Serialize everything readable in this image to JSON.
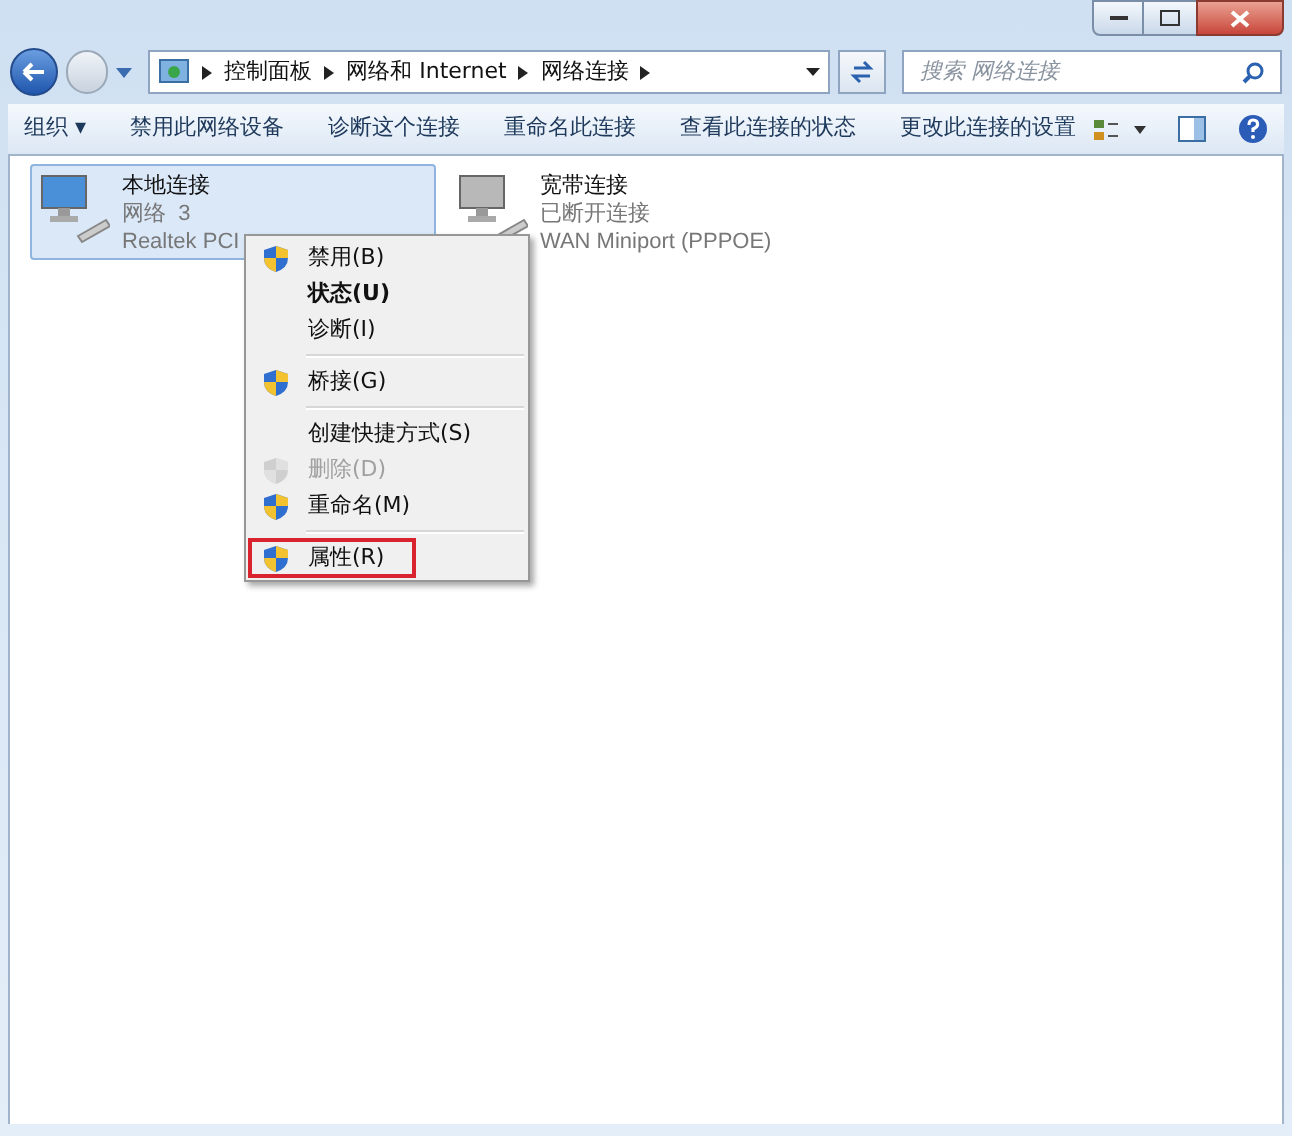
{
  "address_bar": {
    "crumbs": [
      "控制面板",
      "网络和 Internet",
      "网络连接"
    ]
  },
  "search": {
    "placeholder": "搜索 网络连接"
  },
  "toolbar": {
    "items": [
      "组织 ▾",
      "禁用此网络设备",
      "诊断这个连接",
      "重命名此连接",
      "查看此连接的状态",
      "更改此连接的设置"
    ]
  },
  "connections": [
    {
      "name": "本地连接",
      "status": "网络  3",
      "device": "Realtek PCI",
      "selected": true
    },
    {
      "name": "宽带连接",
      "status": "已断开连接",
      "device": "WAN Miniport (PPPOE)",
      "selected": false
    }
  ],
  "context_menu": {
    "groups": [
      [
        {
          "label": "禁用(B)",
          "shield": true,
          "default": false,
          "disabled": false,
          "highlighted": false
        },
        {
          "label": "状态(U)",
          "shield": false,
          "default": true,
          "disabled": false,
          "highlighted": false
        },
        {
          "label": "诊断(I)",
          "shield": false,
          "default": false,
          "disabled": false,
          "highlighted": false
        }
      ],
      [
        {
          "label": "桥接(G)",
          "shield": true,
          "default": false,
          "disabled": false,
          "highlighted": false
        }
      ],
      [
        {
          "label": "创建快捷方式(S)",
          "shield": false,
          "default": false,
          "disabled": false,
          "highlighted": false
        },
        {
          "label": "删除(D)",
          "shield": true,
          "default": false,
          "disabled": true,
          "highlighted": false
        },
        {
          "label": "重命名(M)",
          "shield": true,
          "default": false,
          "disabled": false,
          "highlighted": false
        }
      ],
      [
        {
          "label": "属性(R)",
          "shield": true,
          "default": false,
          "disabled": false,
          "highlighted": true
        }
      ]
    ]
  }
}
